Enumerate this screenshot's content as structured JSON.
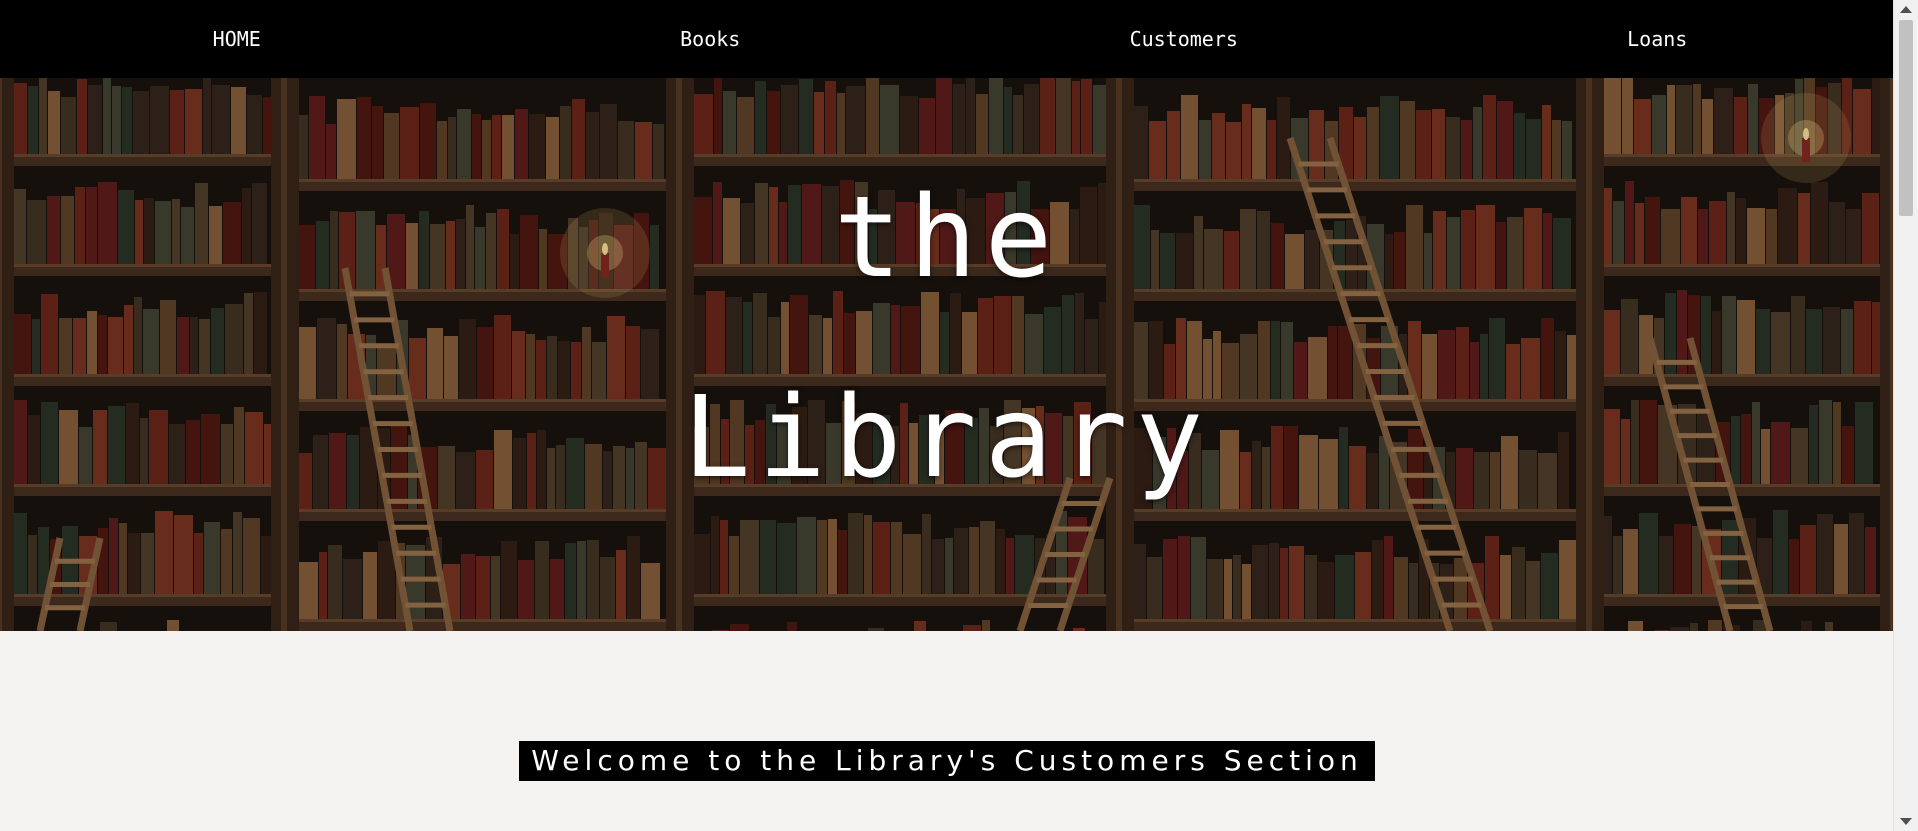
{
  "nav": {
    "items": [
      {
        "label": "HOME"
      },
      {
        "label": "Books"
      },
      {
        "label": "Customers"
      },
      {
        "label": "Loans"
      }
    ]
  },
  "hero": {
    "title_line1": "the",
    "title_line2": "Library",
    "background": "library bookshelves with ladders and candles"
  },
  "welcome": {
    "text": "Welcome to the Library's Customers Section"
  },
  "colors": {
    "nav_bg": "#000000",
    "page_bg": "#f4f3f1",
    "text_light": "#ffffff"
  }
}
